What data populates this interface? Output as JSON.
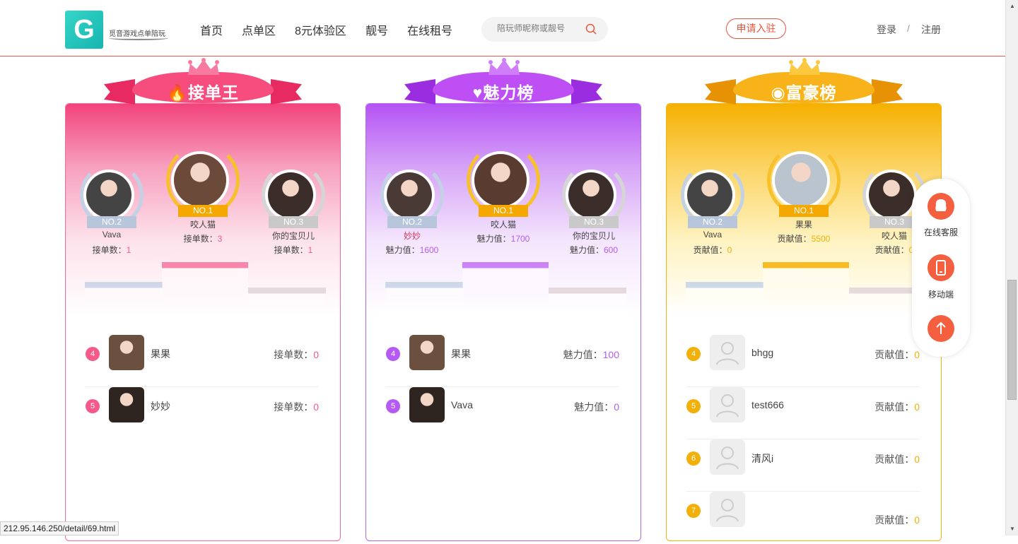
{
  "header": {
    "logo_text": "觅音游戏点单陪玩",
    "nav": [
      "首页",
      "点单区",
      "8元体验区",
      "靓号",
      "在线租号"
    ],
    "search_placeholder": "陪玩师昵称或靓号",
    "apply_label": "申请入驻",
    "login_label": "登录",
    "separator": "/",
    "register_label": "注册"
  },
  "colors": {
    "accent": "#e8553e",
    "pink": "#f64d7e",
    "purple": "#bd4ff5",
    "gold": "#f8b31a"
  },
  "boards": [
    {
      "title": "接单王",
      "icon": "flame-icon",
      "stat_label": "接单数：",
      "top": [
        {
          "rank": "NO.2",
          "name": "Vava",
          "value": "1"
        },
        {
          "rank": "NO.1",
          "name": "咬人猫",
          "value": "3"
        },
        {
          "rank": "NO.3",
          "name": "你的宝贝儿",
          "value": "1"
        }
      ],
      "list": [
        {
          "rank": "4",
          "name": "果果",
          "value": "0"
        },
        {
          "rank": "5",
          "name": "妙妙",
          "value": "0"
        }
      ]
    },
    {
      "title": "魅力榜",
      "icon": "heart-icon",
      "stat_label": "魅力值：",
      "top": [
        {
          "rank": "NO.2",
          "name": "妙妙",
          "value": "1600"
        },
        {
          "rank": "NO.1",
          "name": "咬人猫",
          "value": "1700"
        },
        {
          "rank": "NO.3",
          "name": "你的宝贝儿",
          "value": "600"
        }
      ],
      "list": [
        {
          "rank": "4",
          "name": "果果",
          "value": "100"
        },
        {
          "rank": "5",
          "name": "Vava",
          "value": "0"
        }
      ]
    },
    {
      "title": "富豪榜",
      "icon": "coins-icon",
      "stat_label": "贡献值：",
      "top": [
        {
          "rank": "NO.2",
          "name": "Vava",
          "value": "0"
        },
        {
          "rank": "NO.1",
          "name": "果果",
          "value": "5500"
        },
        {
          "rank": "NO.3",
          "name": "咬人猫",
          "value": "0"
        }
      ],
      "list": [
        {
          "rank": "4",
          "name": "bhgg",
          "value": "0"
        },
        {
          "rank": "5",
          "name": "test666",
          "value": "0"
        },
        {
          "rank": "6",
          "name": "清风i",
          "value": "0"
        },
        {
          "rank": "7",
          "name": "",
          "value": "0"
        }
      ]
    }
  ],
  "float_bar": {
    "service_label": "在线客服",
    "mobile_label": "移动端",
    "top_icon": "arrow-up-icon"
  },
  "status_url": "212.95.146.250/detail/69.html"
}
